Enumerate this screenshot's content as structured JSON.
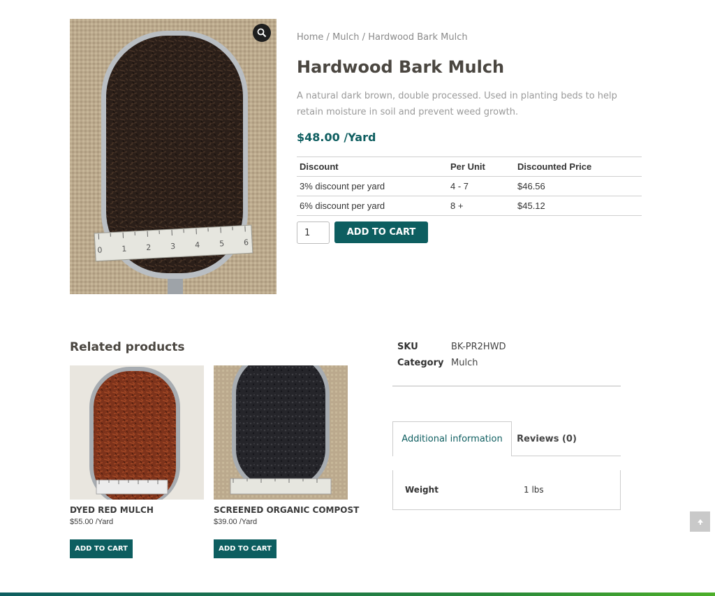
{
  "breadcrumb": {
    "home": "Home",
    "sep1": "/",
    "category": "Mulch",
    "sep2": "/",
    "current": "Hardwood Bark Mulch"
  },
  "product": {
    "title": "Hardwood Bark Mulch",
    "description": "A natural dark brown, double processed. Used in planting beds to help retain moisture in soil and prevent weed growth.",
    "price": "$48.00 /Yard",
    "quantity": "1",
    "add_to_cart_label": "ADD TO CART",
    "image_icon": "zoom-magnifier-icon"
  },
  "discount_table": {
    "headers": [
      "Discount",
      "Per Unit",
      "Discounted Price"
    ],
    "rows": [
      [
        "3% discount per yard",
        "4 - 7",
        "$46.56"
      ],
      [
        "6% discount per yard",
        "8 +",
        "$45.12"
      ]
    ]
  },
  "related": {
    "heading": "Related products",
    "items": [
      {
        "title": "DYED RED MULCH",
        "price": "$55.00 /Yard",
        "button": "ADD TO CART"
      },
      {
        "title": "SCREENED ORGANIC COMPOST",
        "price": "$39.00 /Yard",
        "button": "ADD TO CART"
      }
    ]
  },
  "meta": {
    "sku_label": "SKU",
    "sku_value": "BK-PR2HWD",
    "category_label": "Category",
    "category_value": "Mulch"
  },
  "tabs": [
    {
      "label": "Additional information",
      "active": true
    },
    {
      "label": "Reviews (0)",
      "active": false
    }
  ],
  "additional_info": {
    "label": "Weight",
    "value": "1 lbs"
  },
  "colors": {
    "accent": "#0d5e60",
    "burlap": "#b9a88c",
    "mulch_dark": "#2a1e18",
    "mulch_red": "#8a3a1e"
  },
  "ruler_marks": [
    "0",
    "1",
    "2",
    "3",
    "4",
    "5",
    "6"
  ]
}
